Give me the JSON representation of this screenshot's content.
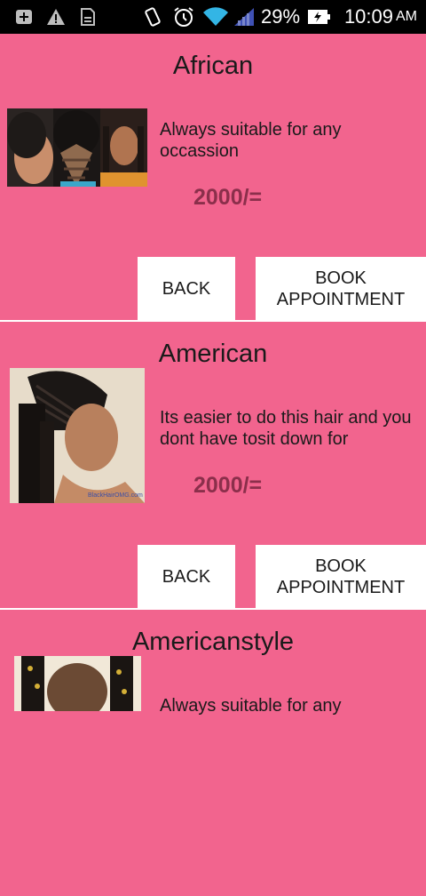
{
  "status_bar": {
    "battery_percent": "29%",
    "time": "10:09",
    "ampm": "AM"
  },
  "cards": [
    {
      "title": "African",
      "description": "Always suitable for any occassion",
      "price": "2000/=",
      "back_label": "BACK",
      "book_label": "BOOK APPOINTMENT"
    },
    {
      "title": "American",
      "description": "Its easier to do this hair and you dont have tosit down for",
      "price": "2000/=",
      "back_label": "BACK",
      "book_label": "BOOK APPOINTMENT",
      "image_watermark": "BlackHairOMG.com"
    },
    {
      "title": "Americanstyle",
      "description": "Always suitable for any"
    }
  ],
  "colors": {
    "background": "#f2648e",
    "price": "#8b2f4b",
    "button_bg": "#ffffff",
    "status_bar": "#000000"
  }
}
